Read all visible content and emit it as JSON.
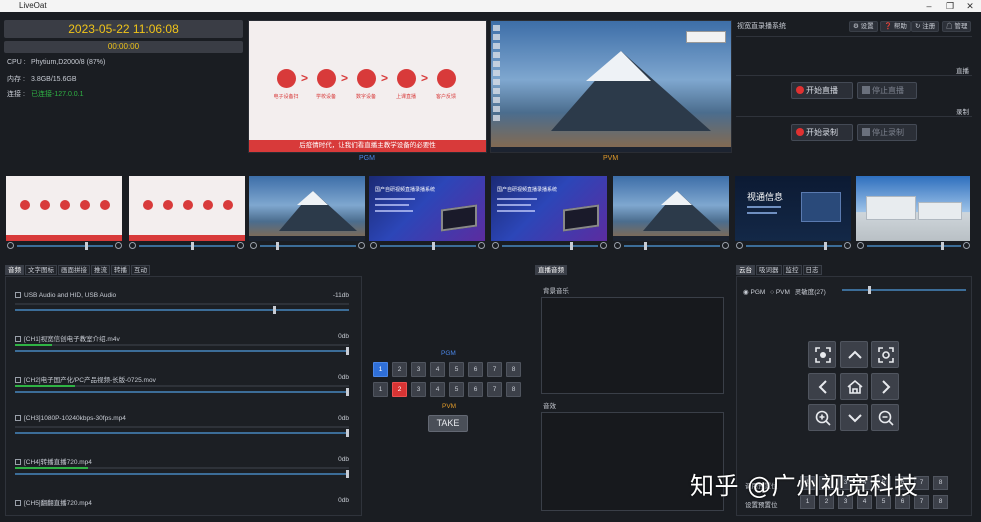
{
  "window": {
    "title": "LiveOat"
  },
  "status": {
    "datetime": "2023-05-22 11:06:08",
    "timer": "00:00:00",
    "rows": [
      {
        "label": "CPU :",
        "value": "Phytium,D2000/8 (87%)"
      },
      {
        "label": "内存 :",
        "value": "3.8GB/15.6GB"
      },
      {
        "label": "连接 :",
        "value": "已连接-127.0.0.1"
      }
    ]
  },
  "monitors": {
    "pgm_label": "PGM",
    "pvm_label": "PVM",
    "slide_caption": "后疫情时代，让我们看直播主教学设备的必要性",
    "slide_steps": [
      "电子设备扫",
      "学校设备",
      "数字设备",
      "上课直播",
      "客户反馈"
    ]
  },
  "thumbnails": {
    "count": 8,
    "promo_title": "国产自研视频直播录播系统",
    "dark_title": "视通信息"
  },
  "control": {
    "title": "视宽直录播系统",
    "top_buttons": [
      "设置",
      "帮助",
      "注册",
      "管理"
    ],
    "live_label": "直播",
    "record_label": "录制",
    "start_live": "开始直播",
    "stop_live": "停止直播",
    "start_record": "开始录制",
    "stop_record": "停止录制"
  },
  "left_tabs": [
    "音频",
    "文字图标",
    "画面拼接",
    "推流",
    "转播",
    "互动"
  ],
  "audio": [
    {
      "name": "USB Audio and HID, USB Audio",
      "db": "-11db",
      "level": 0.0,
      "volume": 0.78
    },
    {
      "name": "[CH1]视宽信创电子教室介绍.m4v",
      "db": "0db",
      "level": 0.11,
      "volume": 1.0
    },
    {
      "name": "[CH2]电子国产化/PC产品视频-长版-0725.mov",
      "db": "0db",
      "level": 0.18,
      "volume": 1.0
    },
    {
      "name": "[CH3]1080P-10240kbps-30fps.mp4",
      "db": "0db",
      "level": 0.0,
      "volume": 1.0
    },
    {
      "name": "[CH4]转播直播720.mp4",
      "db": "0db",
      "level": 0.22,
      "volume": 1.0
    },
    {
      "name": "[CH5]翻翻直播720.mp4",
      "db": "0db",
      "level": 0.0,
      "volume": 1.0
    }
  ],
  "bus": {
    "pgm_label": "PGM",
    "pvm_label": "PVM",
    "buttons": [
      "1",
      "2",
      "3",
      "4",
      "5",
      "6",
      "7",
      "8"
    ],
    "pgm_selected": 1,
    "pvm_selected": 2,
    "take_label": "TAKE"
  },
  "media": {
    "tab": "直播音频",
    "bgm_label": "背景音乐",
    "effect_label": "音效"
  },
  "ptz": {
    "tabs": [
      "云台",
      "吸词器",
      "监控",
      "日志"
    ],
    "radio_pgm": "PGM",
    "radio_pvm": "PVM",
    "sensitivity_label": "灵敏度(27)",
    "sensitivity": 27,
    "preset_label_call": "调用预置位",
    "preset_label_set": "设置预置位",
    "presets": [
      "1",
      "2",
      "3",
      "4",
      "5",
      "6",
      "7",
      "8"
    ]
  },
  "watermark": "知乎 @广州视宽科技",
  "colors": {
    "accent_blue": "#2f6fd8",
    "accent_red": "#d73434",
    "clock_yellow": "#f0c419",
    "meter_green": "#2fb344"
  }
}
